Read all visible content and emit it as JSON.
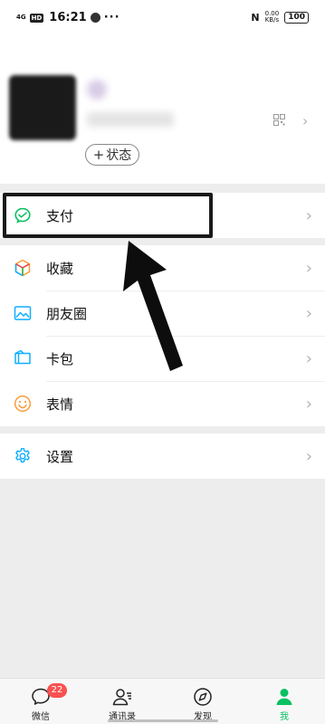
{
  "status_bar": {
    "signal": "4G",
    "hd": "HD",
    "time": "16:21",
    "dots": "···",
    "nfc": "N",
    "net_speed": "0.00",
    "net_unit": "KB/s",
    "battery": "100"
  },
  "profile": {
    "status_button": "状态",
    "status_plus": "+"
  },
  "menu": {
    "pay": "支付",
    "favorites": "收藏",
    "moments": "朋友圈",
    "cards": "卡包",
    "stickers": "表情",
    "settings": "设置"
  },
  "tabbar": {
    "chats": "微信",
    "chats_badge": "22",
    "contacts": "通讯录",
    "discover": "发现",
    "me": "我"
  },
  "colors": {
    "accent": "#07c160",
    "badge": "#fa5151",
    "background": "#ededed"
  }
}
